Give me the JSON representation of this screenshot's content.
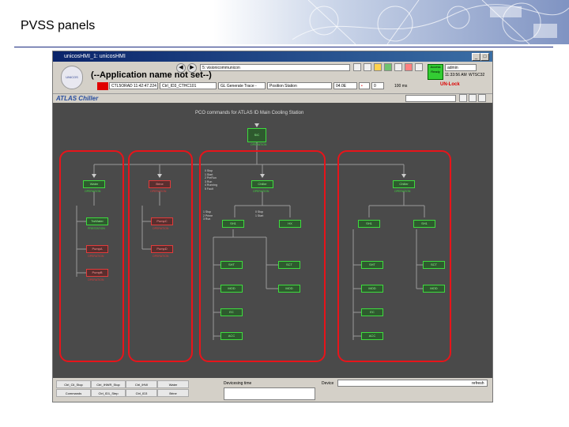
{
  "slide": {
    "title": "PVSS panels"
  },
  "window": {
    "title": "unicosHMI_1: unicosHMI",
    "controls": [
      "_",
      "□",
      "x"
    ]
  },
  "toolbar": {
    "app_name": "(--Application name not set--)",
    "url_value": "5: visionicommunicon",
    "access_label": "Access Ready",
    "user_field": "admin",
    "time": "11:33:56 AM",
    "node_name": "WTSC32",
    "unlock_label": "UN-Lock",
    "row2": {
      "timestamp": "CTL5ORAD 11:42:47.224",
      "device": "Ctrl_ID3_CTHC101",
      "description": "GL Generate Trace - Item1",
      "position": "Position Station",
      "field_value": "04.0E",
      "count": "0",
      "rate": "100 ms"
    },
    "logo_label": "UNICOS"
  },
  "atlas_label": "ATLAS Chiller",
  "panel": {
    "heading": "PCO commands for ATLAS ID Main Cooling Station",
    "nodes": {
      "top": {
        "label": "SIC",
        "status": "OPERATION"
      },
      "water": {
        "label": "Water",
        "status": "OPERATION"
      },
      "brine": {
        "label": "Brine",
        "status": "OPERATION"
      },
      "chiller1": {
        "label": "Chiller",
        "status": "OPERATION"
      },
      "chiller2": {
        "label": "Chiller",
        "status": "OPERATION"
      },
      "twater": {
        "label": "TwWater",
        "status": "PRESTATION"
      },
      "pump1": {
        "label": "PumpA",
        "status": "OPERATION"
      },
      "pump2": {
        "label": "PumpB",
        "status": "OPERATION"
      },
      "pump3": {
        "label": "PumpC",
        "status": "OPERATION"
      },
      "pump4": {
        "label": "PumpD",
        "status": "OPERATION"
      },
      "sh1": {
        "label": "SH1",
        "status": ""
      },
      "sh2": {
        "label": "SH1",
        "status": ""
      },
      "sh3": {
        "label": "SH1",
        "status": ""
      },
      "hx": {
        "label": "HX",
        "status": ""
      },
      "sht": {
        "label": "SHT",
        "status": ""
      },
      "sct": {
        "label": "SCT",
        "status": ""
      },
      "sht2": {
        "label": "SHT",
        "status": ""
      },
      "sct2": {
        "label": "SCT",
        "status": ""
      },
      "mod": {
        "label": "MOD",
        "status": ""
      },
      "mod2": {
        "label": "MOD",
        "status": ""
      },
      "mod3": {
        "label": "MOD",
        "status": ""
      },
      "mod4": {
        "label": "MOD",
        "status": ""
      },
      "ec": {
        "label": "EC",
        "status": ""
      },
      "ec2": {
        "label": "EC",
        "status": ""
      },
      "acc": {
        "label": "ACC",
        "status": ""
      },
      "acc2": {
        "label": "ACC",
        "status": ""
      }
    },
    "cmdlist_a": [
      "0 Stop",
      "1 Start",
      "2 PreRun",
      "3 Run",
      "4 Running",
      "5 Fault"
    ],
    "cmdlist_b": [
      "1 Stop",
      "2 Prime",
      "3 Run"
    ],
    "cmdlist_c": [
      "0 Stop",
      "1 Start"
    ],
    "cmdlist_d": [
      "1 Stop",
      "2 Prime",
      "3 Run"
    ]
  },
  "statusbar": {
    "row1": [
      "Ctrl_Cli_Stop",
      "Ctrl_IHWR_Stop",
      "Ctrl_IHW",
      "Water"
    ],
    "row2": [
      "Commands",
      "Ctrl_ID1_Step",
      "Ctrl_ID3",
      "Brine"
    ],
    "filter_label": "Devicesing time",
    "device_label": "Device",
    "refresh_label": "refresh"
  }
}
